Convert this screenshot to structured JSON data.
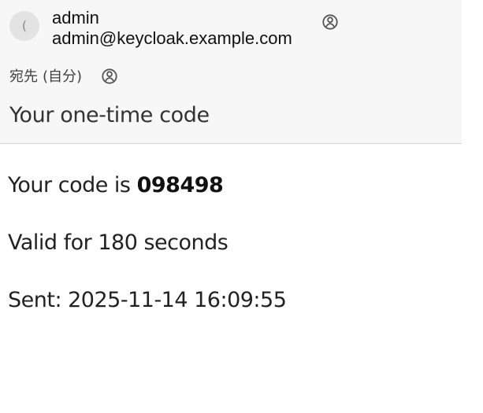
{
  "sender": {
    "avatar_initial": "(",
    "name": "admin",
    "email": "admin@keycloak.example.com",
    "contact_icon": "contact-card-icon"
  },
  "recipient": {
    "label": "宛先",
    "name": "(自分)",
    "contact_icon": "contact-card-icon"
  },
  "subject": "Your one-time code",
  "body": {
    "code_prefix": "Your code is ",
    "code": "098498",
    "validity": "Valid for 180 seconds",
    "sent": "Sent: 2025-11-14 16:09:55"
  }
}
